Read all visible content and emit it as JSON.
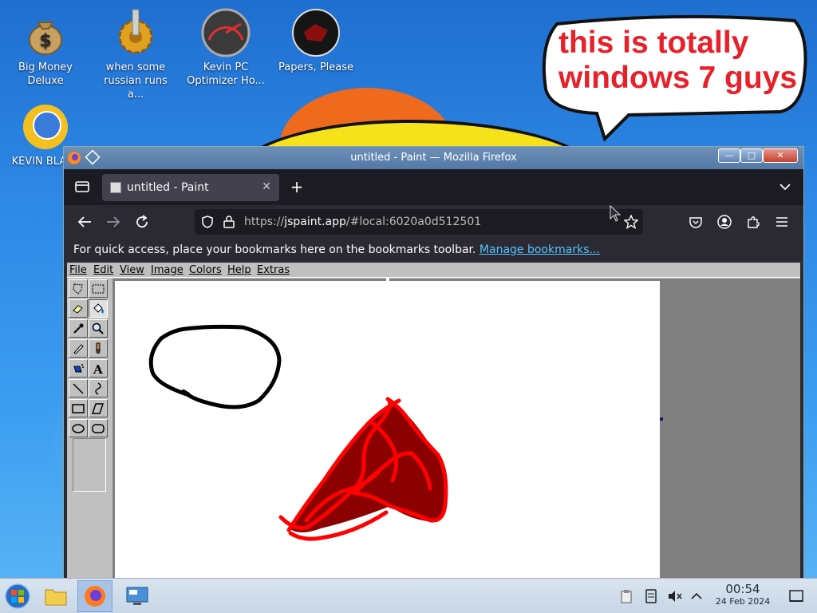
{
  "desktop": {
    "icons": [
      {
        "label": "Big Money Deluxe",
        "icon": "money-bag-icon"
      },
      {
        "label": "when some russian runs a...",
        "icon": "gear-icon"
      },
      {
        "label": "Kevin PC Optimizer Ho...",
        "icon": "speedometer-icon"
      },
      {
        "label": "Papers, Please",
        "icon": "papers-please-icon"
      },
      {
        "label": "KEVIN BLAST",
        "icon": "sun-globe-icon"
      }
    ],
    "speech_bubble": "this is totally windows 7 guys"
  },
  "window": {
    "title": "untitled - Paint — Mozilla Firefox",
    "tab": {
      "label": "untitled - Paint"
    },
    "url": {
      "prefix": "https://",
      "host": "jspaint.app",
      "rest": "/#local:6020a0d512501"
    },
    "bookmarks": {
      "message": "For quick access, place your bookmarks here on the bookmarks toolbar.",
      "link": "Manage bookmarks..."
    }
  },
  "paint": {
    "menu": [
      "File",
      "Edit",
      "View",
      "Image",
      "Colors",
      "Help",
      "Extras"
    ],
    "tools": [
      "free-form-select",
      "select",
      "eraser",
      "fill",
      "pick-color",
      "magnifier",
      "pencil",
      "brush",
      "airbrush",
      "text",
      "line",
      "curve",
      "rectangle",
      "polygon",
      "ellipse",
      "rounded-rectangle"
    ],
    "selected_tool": "fill",
    "drawing_colors": {
      "outline": "#000000",
      "stroke": "#ff0000",
      "fill": "#8b0000"
    }
  },
  "taskbar": {
    "time": "00:54",
    "date": "24 Feb 2024"
  }
}
